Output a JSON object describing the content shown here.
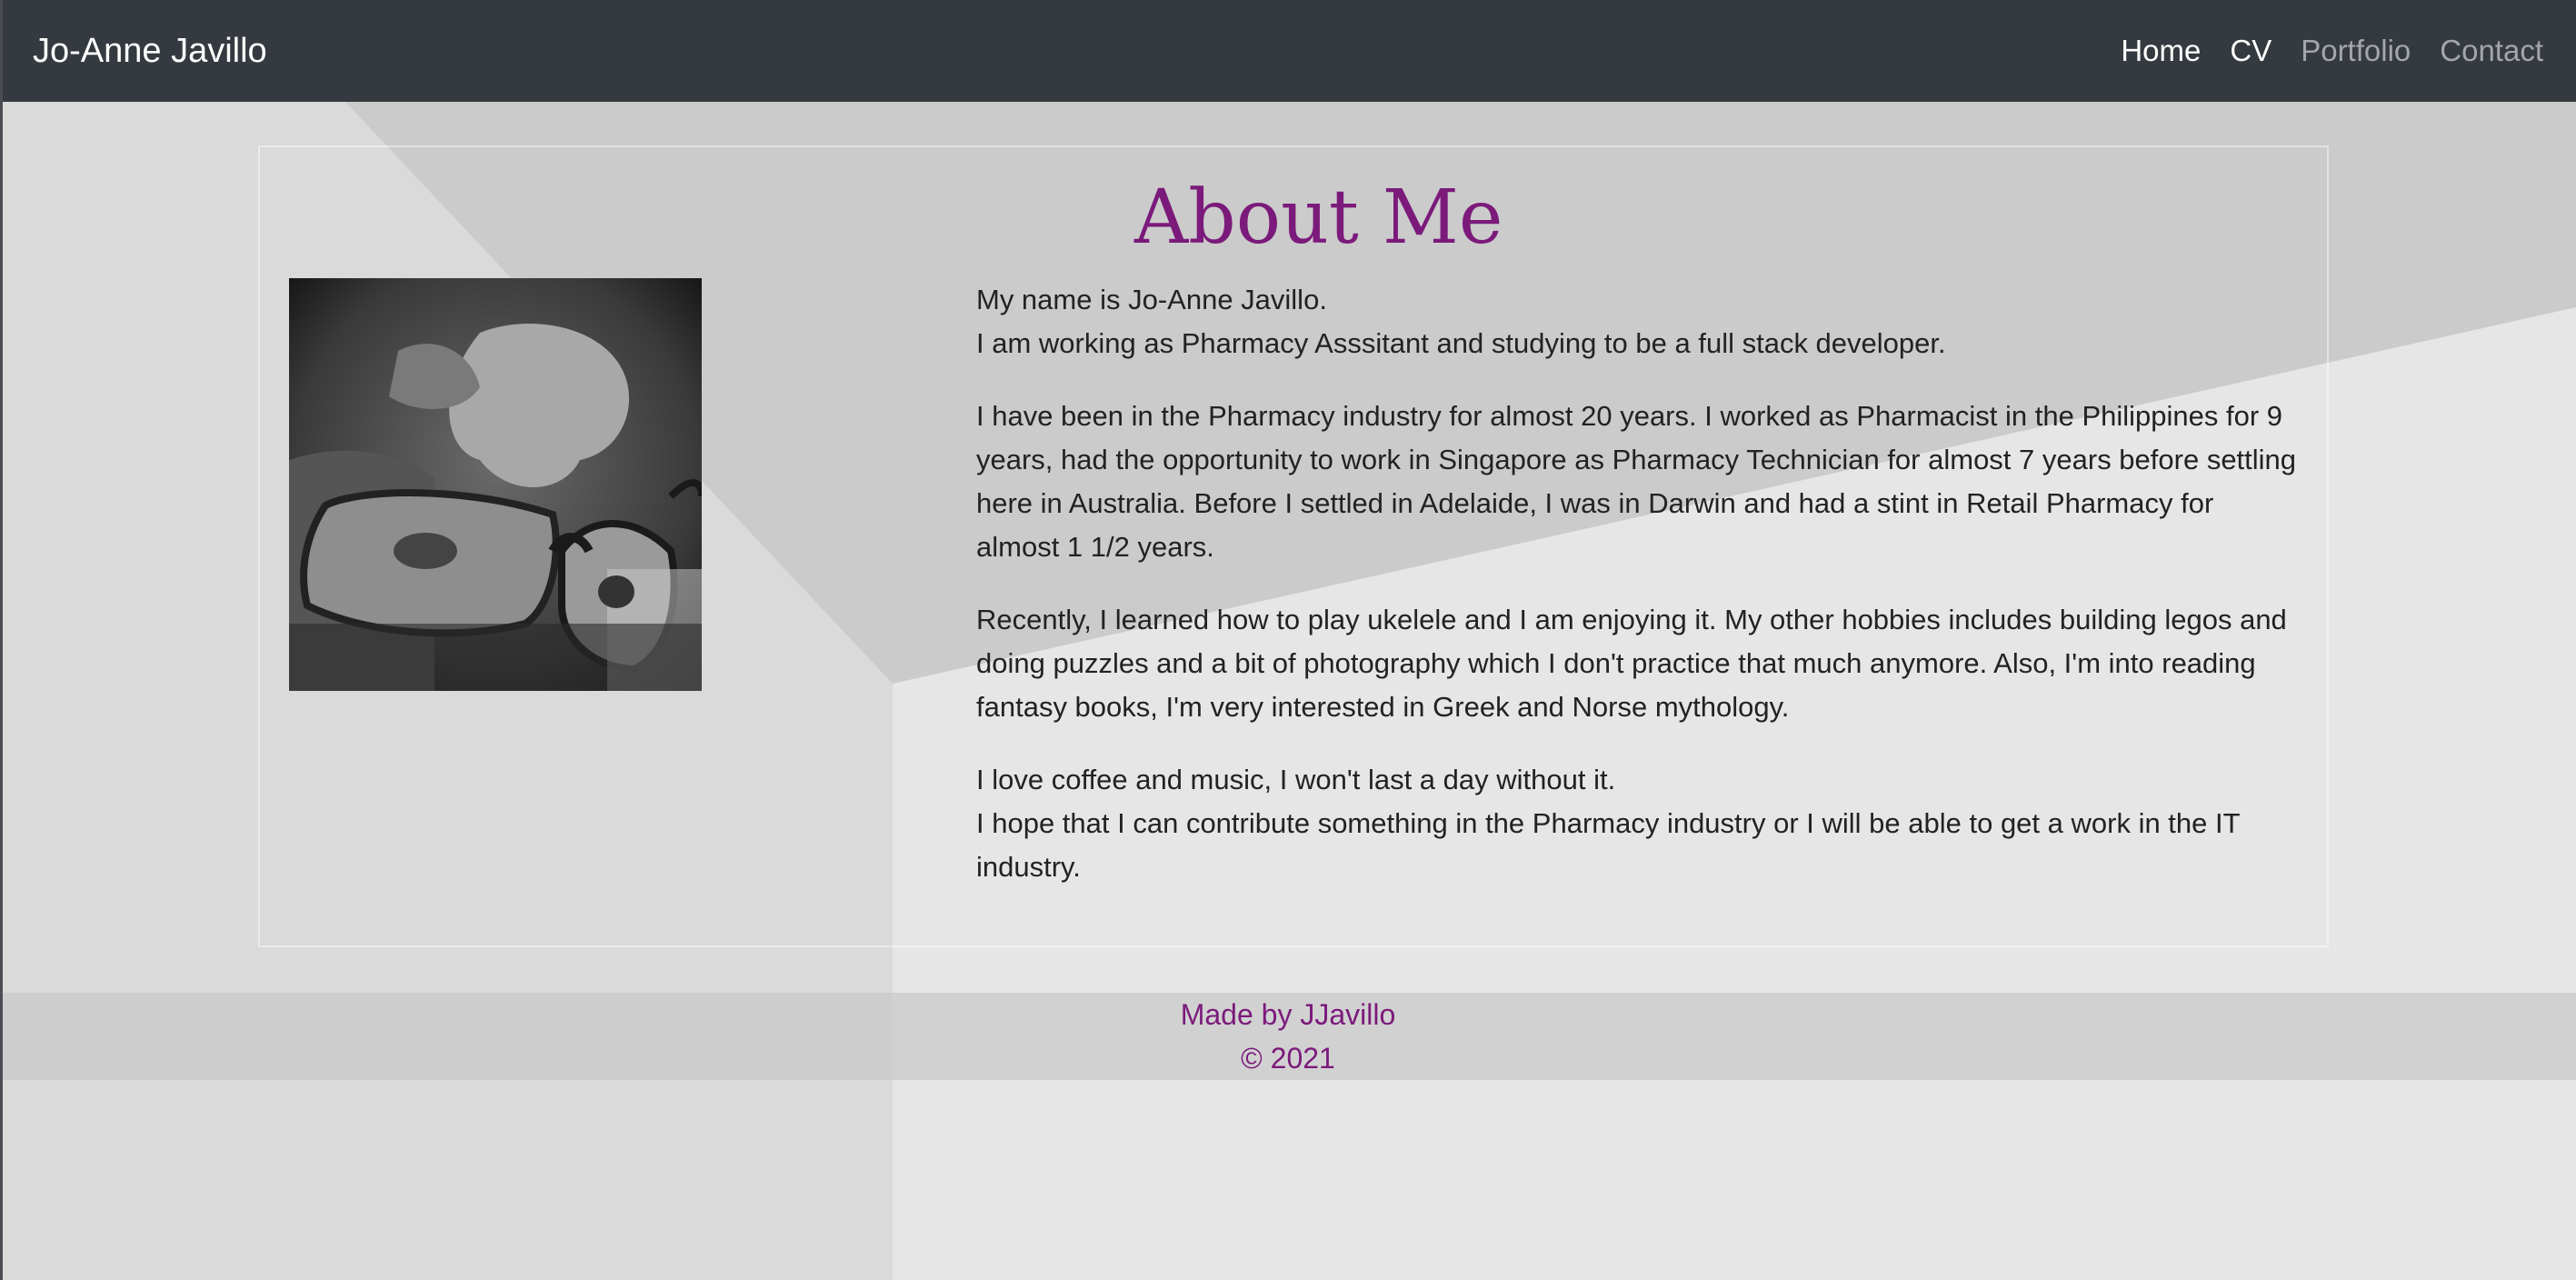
{
  "colors": {
    "navbar_bg": "#343a40",
    "accent_purple": "#7b1a7b",
    "nav_active": "#ffffff",
    "nav_muted": "#a3a6aa",
    "page_bg": "#e6e6e6"
  },
  "navbar": {
    "brand": "Jo-Anne Javillo",
    "links": [
      {
        "label": "Home",
        "state": "active"
      },
      {
        "label": "CV",
        "state": "active"
      },
      {
        "label": "Portfolio",
        "state": "muted"
      },
      {
        "label": "Contact",
        "state": "muted"
      }
    ]
  },
  "about": {
    "title": "About Me",
    "photo_icon": "profile-photo",
    "paragraphs": [
      {
        "lines": [
          "My name is Jo-Anne Javillo.",
          "I am working as Pharmacy Asssitant and studying to be a full stack developer."
        ]
      },
      {
        "lines": [
          "I have been in the Pharmacy industry for almost 20 years. I worked as Pharmacist in the Philippines for 9 years, had the opportunity to work in Singapore as Pharmacy Technician for almost 7 years before settling here in Australia. Before I settled in Adelaide, I was in Darwin and had a stint in Retail Pharmacy for almost 1 1/2 years."
        ]
      },
      {
        "lines": [
          "Recently, I learned how to play ukelele and I am enjoying it. My other hobbies includes building legos and doing puzzles and a bit of photography which I don't practice that much anymore. Also, I'm into reading fantasy books, I'm very interested in Greek and Norse mythology."
        ]
      },
      {
        "lines": [
          "I love coffee and music, I won't last a day without it.",
          "I hope that I can contribute something in the Pharmacy industry or I will be able to get a work in the IT industry."
        ]
      }
    ]
  },
  "footer": {
    "made_by": "Made by JJavillo",
    "copyright": "© 2021"
  }
}
